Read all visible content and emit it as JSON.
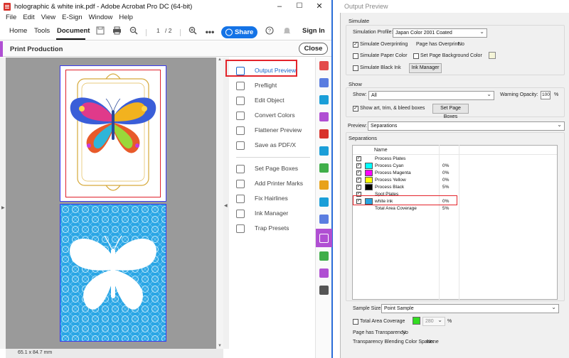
{
  "acrobat": {
    "title": "holographic & white ink.pdf - Adobe Acrobat Pro DC (64-bit)",
    "menu": [
      "File",
      "Edit",
      "View",
      "E-Sign",
      "Window",
      "Help"
    ],
    "tabs": {
      "home": "Home",
      "tools": "Tools",
      "document": "Document"
    },
    "page_current": "1",
    "page_total": "/ 2",
    "share_label": "Share",
    "signin_label": "Sign In",
    "panel_title": "Print Production",
    "close_label": "Close",
    "page_size": "65.1 x 84.7 mm",
    "tools_group1": [
      "Output Preview",
      "Preflight",
      "Edit Object",
      "Convert Colors",
      "Flattener Preview",
      "Save as PDF/X"
    ],
    "tools_group2": [
      "Set Page Boxes",
      "Add Printer Marks",
      "Fix Hairlines",
      "Ink Manager",
      "Trap Presets"
    ],
    "rail_colors": [
      "#e34a4a",
      "#5a7de0",
      "#1a9ed8",
      "#b04fd3",
      "#d8322b",
      "#1a9ed8",
      "#3fae49",
      "#e8a21a",
      "#1a9ed8",
      "#5a7de0",
      "#ffffff",
      "#3fae49",
      "#b04fd3",
      "#555555"
    ]
  },
  "output_preview": {
    "title": "Output Preview",
    "simulate": {
      "heading": "Simulate",
      "profile_label": "Simulation Profile:",
      "profile_value": "Japan Color 2001 Coated",
      "sim_overprinting": "Simulate Overprinting",
      "page_has_overprint_label": "Page has Overprint:",
      "page_has_overprint_value": "No",
      "sim_paper_color": "Simulate Paper Color",
      "set_page_bg": "Set Page Background Color",
      "sim_black_ink": "Simulate Black Ink",
      "ink_manager": "Ink Manager"
    },
    "show": {
      "heading": "Show",
      "show_label": "Show:",
      "show_value": "All",
      "warning_opacity_label": "Warning Opacity:",
      "warning_opacity_value": "100",
      "percent": "%",
      "show_boxes": "Show art, trim, & bleed boxes",
      "set_page_boxes": "Set Page Boxes"
    },
    "preview_label": "Preview:",
    "preview_value": "Separations",
    "separations": {
      "heading": "Separations",
      "col_name": "Name",
      "rows": [
        {
          "name": "Process Plates",
          "pct": "",
          "swatch": "",
          "checked": true
        },
        {
          "name": "Process Cyan",
          "pct": "0%",
          "swatch": "#00ffff",
          "checked": true
        },
        {
          "name": "Process Magenta",
          "pct": "0%",
          "swatch": "#ff00ff",
          "checked": true
        },
        {
          "name": "Process Yellow",
          "pct": "0%",
          "swatch": "#ffff00",
          "checked": true
        },
        {
          "name": "Process Black",
          "pct": "5%",
          "swatch": "#000000",
          "checked": true
        },
        {
          "name": "Spot Plates",
          "pct": "",
          "swatch": "",
          "checked": true
        },
        {
          "name": "white ink",
          "pct": "0%",
          "swatch": "#29a3e0",
          "checked": true
        },
        {
          "name": "Total Area Coverage",
          "pct": "5%",
          "swatch": "",
          "checked": false
        }
      ]
    },
    "sample_size_label": "Sample Size:",
    "sample_size_value": "Point Sample",
    "total_area_label": "Total Area Coverage",
    "total_area_value": "280",
    "total_area_swatch": "#33dd22",
    "page_transparency_label": "Page has Transparency:",
    "page_transparency_value": "No",
    "blend_space_label": "Transparency Blending Color Space:",
    "blend_space_value": "None"
  }
}
